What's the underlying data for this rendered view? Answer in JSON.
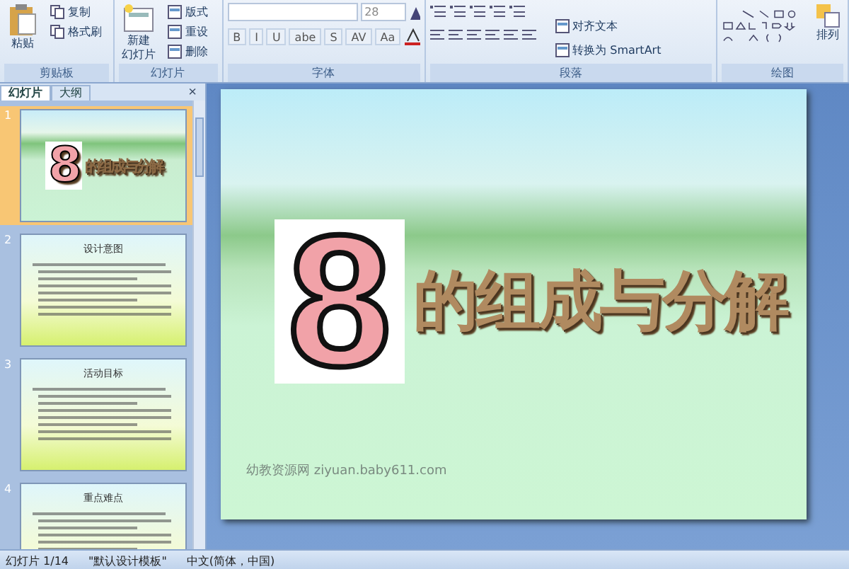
{
  "ribbon": {
    "groups": [
      {
        "kind": "clipboard",
        "label": "剪贴板",
        "big_button": "粘贴",
        "items": [
          "复制",
          "格式刷"
        ]
      },
      {
        "kind": "slides",
        "label": "幻灯片",
        "big_button": [
          "新建",
          "幻灯片"
        ],
        "items": [
          "版式",
          "重设",
          "删除"
        ]
      },
      {
        "kind": "font",
        "label": "字体",
        "font_size": "28",
        "format_buttons": [
          "B",
          "I",
          "U",
          "abe",
          "S",
          "AV",
          "Aa"
        ]
      },
      {
        "kind": "paragraph",
        "label": "段落",
        "items": [
          "对齐文本",
          "转换为 SmartArt"
        ]
      },
      {
        "kind": "drawing",
        "label": "绘图",
        "big_button": "排列"
      }
    ]
  },
  "pane": {
    "tabs": [
      {
        "label": "幻灯片",
        "selected": true
      },
      {
        "label": "大纲",
        "selected": false
      }
    ],
    "close": "×",
    "thumbnails": [
      {
        "number": "1",
        "selected": true,
        "kind": "title",
        "digit": "8",
        "title": "的组成与分解"
      },
      {
        "number": "2",
        "selected": false,
        "kind": "text",
        "title": "设计意图"
      },
      {
        "number": "3",
        "selected": false,
        "kind": "text",
        "title": "活动目标"
      },
      {
        "number": "4",
        "selected": false,
        "kind": "text",
        "title": "重点难点"
      }
    ]
  },
  "slide": {
    "digit": "8",
    "title": "的组成与分解",
    "footer": "幼教资源网 ziyuan.baby611.com"
  },
  "status_bar": [
    "幻灯片 1/14",
    "\"默认设计模板\"",
    "中文(简体，中国)"
  ]
}
